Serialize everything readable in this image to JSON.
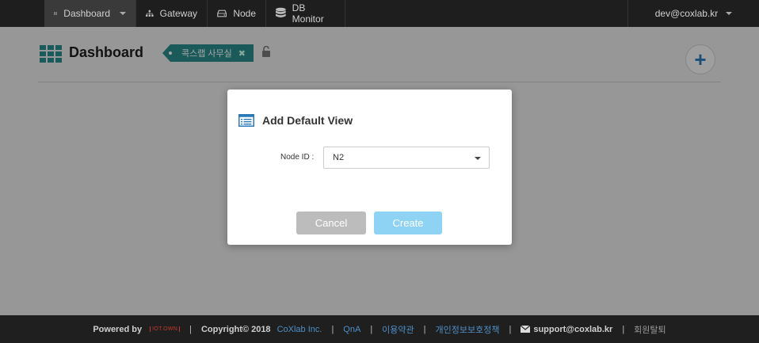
{
  "nav": {
    "items": [
      {
        "label": "Dashboard",
        "icon": "grid-icon"
      },
      {
        "label": "Gateway",
        "icon": "sitemap-icon"
      },
      {
        "label": "Node",
        "icon": "hdd-icon"
      },
      {
        "label": "DB Monitor",
        "icon": "database-icon"
      }
    ],
    "user": "dev@coxlab.kr"
  },
  "header": {
    "title": "Dashboard",
    "tag": "콕스랩 사무실",
    "add_label": "+"
  },
  "modal": {
    "title": "Add Default View",
    "field_label": "Node ID :",
    "node_id_value": "N2",
    "cancel_label": "Cancel",
    "create_label": "Create"
  },
  "footer": {
    "powered_by": "Powered by",
    "logo_text": "IOT.OWN",
    "copyright": "Copyright© 2018",
    "company": "CoXlab Inc.",
    "qna": "QnA",
    "terms": "이용약관",
    "privacy": "개인정보보호정책",
    "support_email": "support@coxlab.kr",
    "withdraw": "회원탈퇴",
    "separator": "|"
  },
  "colors": {
    "accent": "#2a8a8a",
    "primary": "#2a7ab8",
    "create_button": "#8fd3f4"
  }
}
